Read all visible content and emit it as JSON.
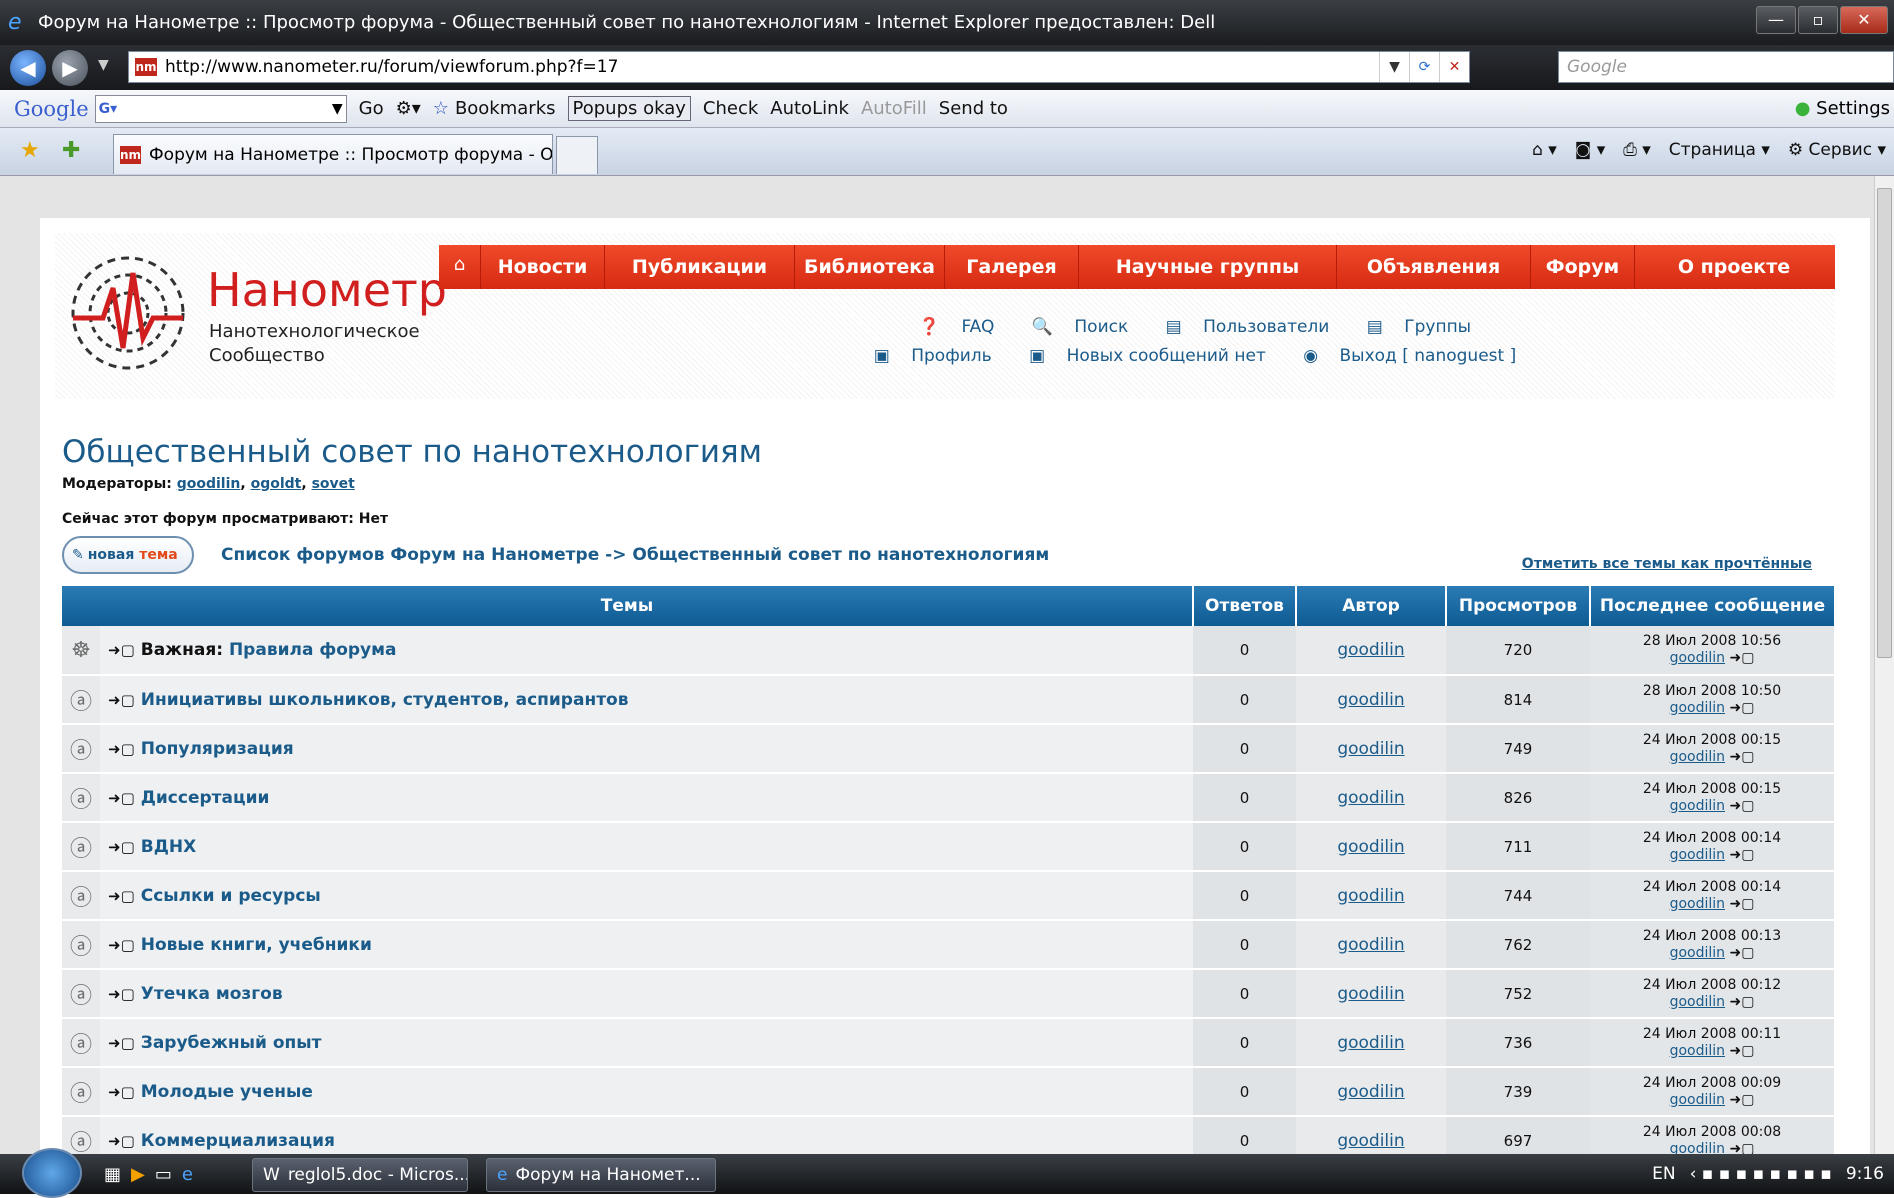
{
  "window": {
    "title": "Форум на Нанометре :: Просмотр форума - Общественный совет по нанотехнологиям - Internet Explorer предоставлен: Dell"
  },
  "address": {
    "url": "http://www.nanometer.ru/forum/viewforum.php?f=17",
    "search_placeholder": "Google"
  },
  "gtoolbar": {
    "logo": "Google",
    "go": "Go",
    "bookmarks": "Bookmarks",
    "popups": "Popups okay",
    "check": "Check",
    "autolink": "AutoLink",
    "autofill": "AutoFill",
    "sendto": "Send to",
    "settings": "Settings"
  },
  "tab": {
    "label": "Форум на Нанометре :: Просмотр форума - О..."
  },
  "ietools": {
    "page": "Страница",
    "service": "Сервис"
  },
  "site": {
    "name": "Нанометр",
    "sub1": "Нанотехнологическое",
    "sub2": "Сообщество"
  },
  "nav": [
    "Новости",
    "Публикации",
    "Библиотека",
    "Галерея",
    "Научные группы",
    "Объявления",
    "Форум",
    "О проекте"
  ],
  "forumlinks": {
    "faq": "FAQ",
    "search": "Поиск",
    "users": "Пользователи",
    "groups": "Группы",
    "profile": "Профиль",
    "newmsg": "Новых сообщений нет",
    "logout": "Выход [ nanoguest ]"
  },
  "forum": {
    "title": "Общественный совет по нанотехнологиям",
    "moderators_label": "Модераторы:",
    "moderators": [
      "goodilin",
      "ogoldt",
      "sovet"
    ],
    "viewing": "Сейчас этот форум просматривают: Нет",
    "newtopic_a": "новая",
    "newtopic_b": "тема",
    "crumb_list": "Список форумов Форум на Нанометре",
    "crumb_sep": "->",
    "crumb_current": "Общественный совет по нанотехнологиям",
    "markread": "Отметить все темы как прочтённые"
  },
  "table": {
    "headers": {
      "topics": "Темы",
      "replies": "Ответов",
      "author": "Автор",
      "views": "Просмотров",
      "last": "Последнее сообщение"
    },
    "important_label": "Важная:",
    "rows": [
      {
        "title": "Правила форума",
        "replies": "0",
        "author": "goodilin",
        "views": "720",
        "date": "28 Июл 2008 10:56",
        "last_author": "goodilin"
      },
      {
        "title": "Инициативы школьников, студентов, аспирантов",
        "replies": "0",
        "author": "goodilin",
        "views": "814",
        "date": "28 Июл 2008 10:50",
        "last_author": "goodilin"
      },
      {
        "title": "Популяризация",
        "replies": "0",
        "author": "goodilin",
        "views": "749",
        "date": "24 Июл 2008 00:15",
        "last_author": "goodilin"
      },
      {
        "title": "Диссертации",
        "replies": "0",
        "author": "goodilin",
        "views": "826",
        "date": "24 Июл 2008 00:15",
        "last_author": "goodilin"
      },
      {
        "title": "ВДНХ",
        "replies": "0",
        "author": "goodilin",
        "views": "711",
        "date": "24 Июл 2008 00:14",
        "last_author": "goodilin"
      },
      {
        "title": "Ссылки и ресурсы",
        "replies": "0",
        "author": "goodilin",
        "views": "744",
        "date": "24 Июл 2008 00:14",
        "last_author": "goodilin"
      },
      {
        "title": "Новые книги, учебники",
        "replies": "0",
        "author": "goodilin",
        "views": "762",
        "date": "24 Июл 2008 00:13",
        "last_author": "goodilin"
      },
      {
        "title": "Утечка мозгов",
        "replies": "0",
        "author": "goodilin",
        "views": "752",
        "date": "24 Июл 2008 00:12",
        "last_author": "goodilin"
      },
      {
        "title": "Зарубежный опыт",
        "replies": "0",
        "author": "goodilin",
        "views": "736",
        "date": "24 Июл 2008 00:11",
        "last_author": "goodilin"
      },
      {
        "title": "Молодые ученые",
        "replies": "0",
        "author": "goodilin",
        "views": "739",
        "date": "24 Июл 2008 00:09",
        "last_author": "goodilin"
      },
      {
        "title": "Коммерциализация",
        "replies": "0",
        "author": "goodilin",
        "views": "697",
        "date": "24 Июл 2008 00:08",
        "last_author": "goodilin"
      }
    ]
  },
  "taskbar": {
    "item1": "reglol5.doc - Micros...",
    "item2": "Форум на Наномет...",
    "lang": "EN",
    "clock": "9:16"
  }
}
